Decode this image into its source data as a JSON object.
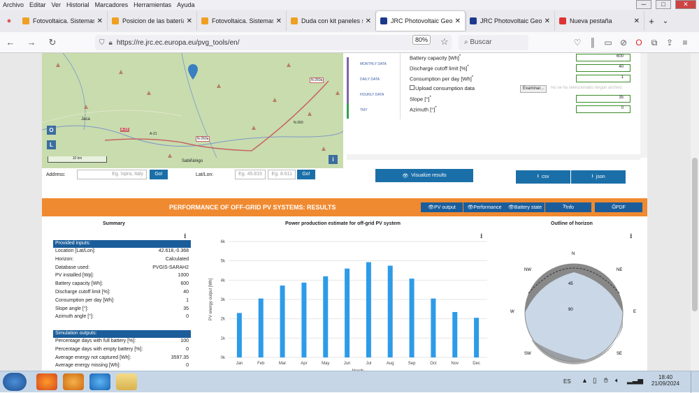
{
  "menubar": {
    "items": [
      "Archivo",
      "Editar",
      "Ver",
      "Historial",
      "Marcadores",
      "Herramientas",
      "Ayuda"
    ]
  },
  "tabs": [
    {
      "title": "Fotovoltaica. Sistemas",
      "color": "#f0a020",
      "active": false
    },
    {
      "title": "Posicion de las baterías",
      "color": "#f0a020",
      "active": false
    },
    {
      "title": "Fotovoltaica. Sistemas",
      "color": "#f0a020",
      "active": false
    },
    {
      "title": "Duda con kit paneles s",
      "color": "#f0a020",
      "active": false
    },
    {
      "title": "JRC Photovoltaic Geog",
      "color": "#1b3a8c",
      "active": true
    },
    {
      "title": "JRC Photovoltaic Geog",
      "color": "#1b3a8c",
      "active": false
    },
    {
      "title": "Nueva pestaña",
      "color": "#d33",
      "active": false
    }
  ],
  "address": {
    "url": "https://re.jrc.ec.europa.eu/pvg_tools/en/",
    "zoom": "80%",
    "search_placeholder": "Buscar"
  },
  "map": {
    "labels": [
      "Jaca",
      "A-23",
      "A-21",
      "N-260a",
      "N-260",
      "N-260a",
      "Sabiñánigo",
      "10 km"
    ],
    "buttons": [
      "O",
      "L"
    ],
    "info": "i"
  },
  "address_row": {
    "address_label": "Address:",
    "address_placeholder": "Eg. Ispra, Italy",
    "go": "Go!",
    "latlon_label": "Lat/Lon:",
    "lat_placeholder": "Eg. 45.815",
    "lon_placeholder": "Eg. 8.611"
  },
  "side_tabs": [
    "MONTHLY DATA",
    "DAILY DATA",
    "HOURLY DATA",
    "TMY"
  ],
  "form": {
    "battery_label": "Battery capacity [Wh]",
    "battery_value": "600",
    "discharge_label": "Discharge cutoff limit [%]",
    "discharge_value": "40",
    "consumption_label": "Consumption per day [Wh]",
    "consumption_value": "1",
    "upload_label": "Upload consumption data",
    "browse_label": "Examinar...",
    "no_file": "No se ha seleccionado ningún archivo.",
    "slope_label": "Slope [°]",
    "slope_value": "35",
    "azimuth_label": "Azimuth [°]",
    "azimuth_value": "0"
  },
  "buttons": {
    "visualize": "Visualize results",
    "csv": "csv",
    "json": "json"
  },
  "results": {
    "title": "PERFORMANCE OF OFF-GRID PV SYSTEMS: RESULTS",
    "pv_output": "PV output",
    "performance": "Performance",
    "battery": "Battery state",
    "info": "Info",
    "pdf": "PDF"
  },
  "summary": {
    "title": "Summary",
    "inputs_head": "Provided inputs:",
    "inputs": [
      [
        "Location [Lat/Lon]:",
        "42.618,-0.368"
      ],
      [
        "Horizon:",
        "Calculated"
      ],
      [
        "Database used:",
        "PVGIS-SARAH2"
      ],
      [
        "PV installed [Wp]:",
        "1000"
      ],
      [
        "Battery capacity [Wh]:",
        "600"
      ],
      [
        "Discharge cutoff limit [%]:",
        "40"
      ],
      [
        "Consumption per day [Wh]:",
        "1"
      ],
      [
        "Slope angle [°]:",
        "35"
      ],
      [
        "Azimuth angle [°]:",
        "0"
      ]
    ],
    "outputs_head": "Simulation outputs:",
    "outputs": [
      [
        "Percentage days with full battery [%]:",
        "100"
      ],
      [
        "Percentage days with empty battery [%]:",
        "0"
      ],
      [
        "Average energy not captured [Wh]:",
        "3597.35"
      ],
      [
        "Average energy missing [Wh]:",
        "0"
      ]
    ]
  },
  "chart_data": {
    "type": "bar",
    "title": "Power production estimate for off-grid PV system",
    "xlabel": "Month",
    "ylabel": "PV energy output [Wh]",
    "categories": [
      "Jan",
      "Feb",
      "Mar",
      "Apr",
      "May",
      "Jun",
      "Jul",
      "Aug",
      "Sep",
      "Oct",
      "Nov",
      "Dec"
    ],
    "values": [
      2300,
      3050,
      3720,
      3870,
      4200,
      4600,
      4930,
      4750,
      4080,
      3050,
      2350,
      2050
    ],
    "ylim": [
      0,
      6000
    ],
    "yticks": [
      "0k",
      "1k",
      "2k",
      "3k",
      "4k",
      "5k",
      "6k"
    ],
    "bar_color": "#2d9be8",
    "grid": true
  },
  "horizon": {
    "title": "Outline of horizon",
    "labels": [
      "N",
      "NE",
      "E",
      "SE",
      "SW",
      "W",
      "NW",
      "45",
      "90"
    ]
  },
  "taskbar": {
    "lang": "ES",
    "time": "18:40",
    "date": "21/09/2024"
  }
}
